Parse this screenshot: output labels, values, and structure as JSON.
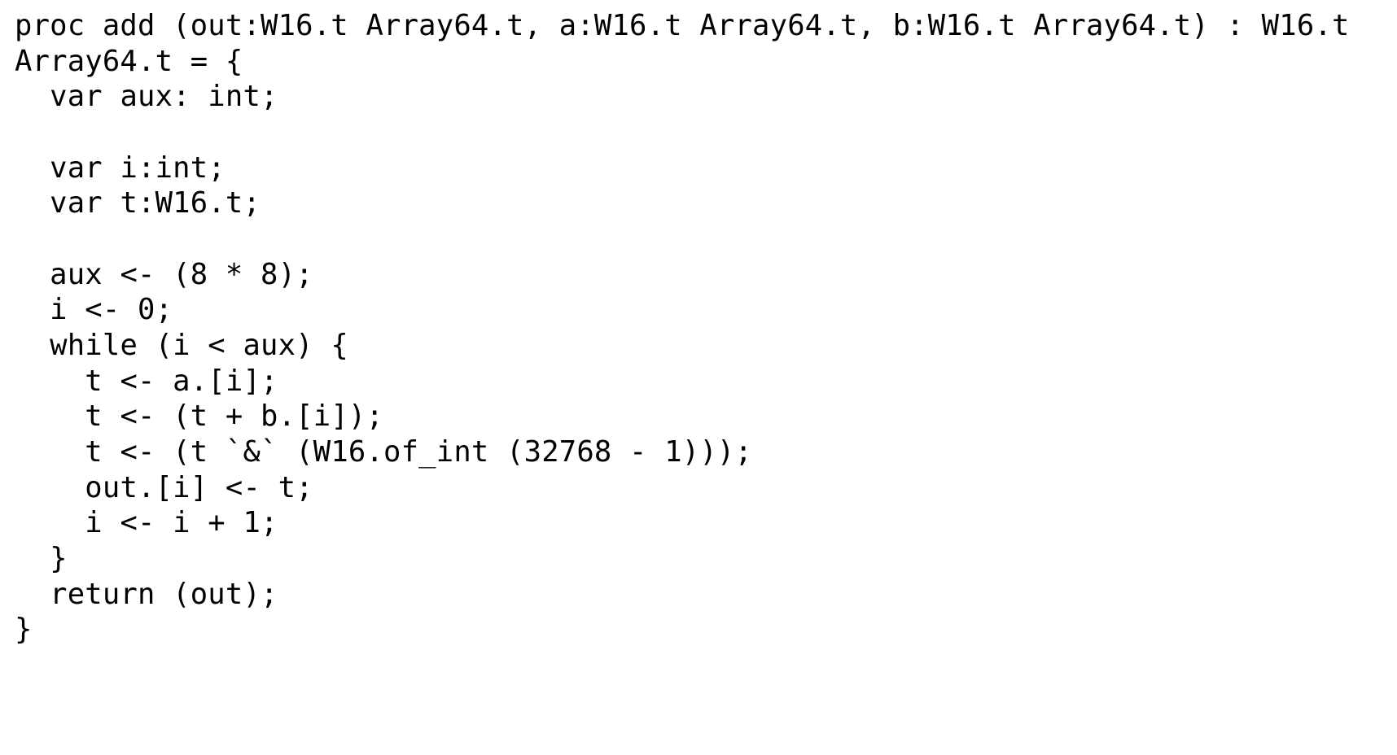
{
  "code": {
    "lines": [
      "proc add (out:W16.t Array64.t, a:W16.t Array64.t, b:W16.t Array64.t) : W16.t Array64.t = {",
      "  var aux: int;",
      "",
      "  var i:int;",
      "  var t:W16.t;",
      "",
      "  aux <- (8 * 8);",
      "  i <- 0;",
      "  while (i < aux) {",
      "    t <- a.[i];",
      "    t <- (t + b.[i]);",
      "    t <- (t `&` (W16.of_int (32768 - 1)));",
      "    out.[i] <- t;",
      "    i <- i + 1;",
      "  }",
      "  return (out);",
      "}"
    ]
  }
}
